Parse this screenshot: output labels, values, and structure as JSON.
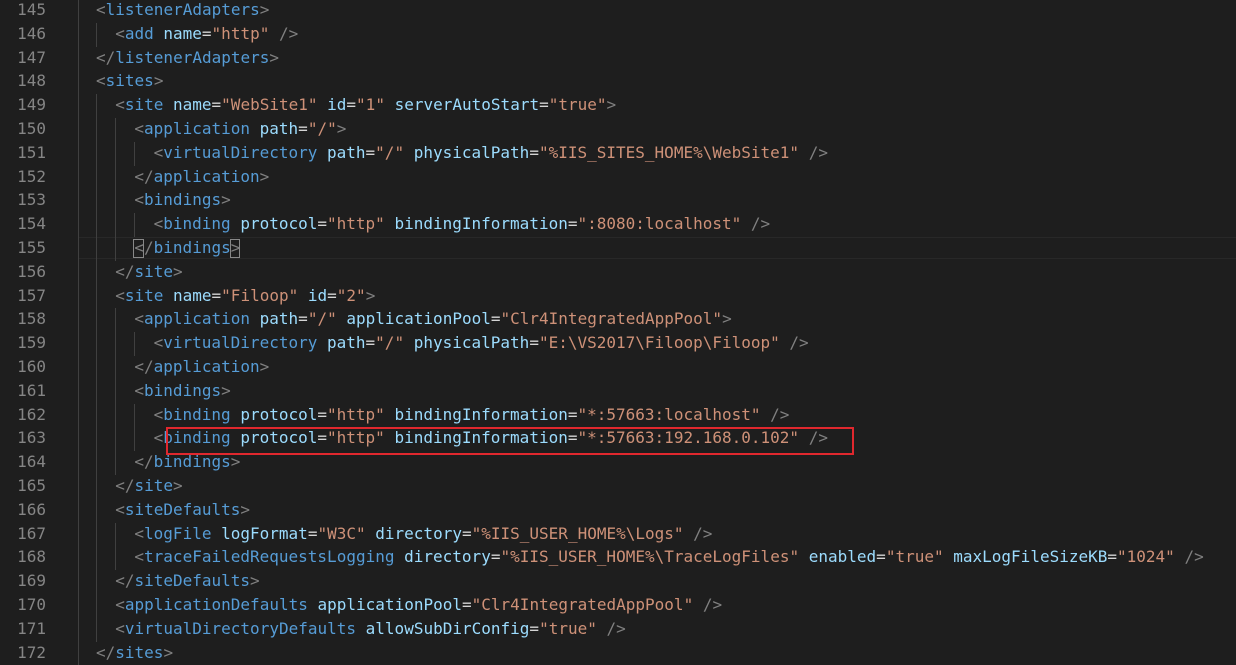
{
  "editor": {
    "lines": [
      {
        "num": "145",
        "indent": 1,
        "tokens": [
          [
            "p",
            "<"
          ],
          [
            "t",
            "listenerAdapters"
          ],
          [
            "p",
            ">"
          ]
        ]
      },
      {
        "num": "146",
        "indent": 2,
        "tokens": [
          [
            "p",
            "<"
          ],
          [
            "t",
            "add"
          ],
          [
            "x",
            " "
          ],
          [
            "a",
            "name"
          ],
          [
            "e",
            "="
          ],
          [
            "s",
            "\"http\""
          ],
          [
            "x",
            " "
          ],
          [
            "p",
            "/>"
          ]
        ]
      },
      {
        "num": "147",
        "indent": 1,
        "tokens": [
          [
            "p",
            "</"
          ],
          [
            "t",
            "listenerAdapters"
          ],
          [
            "p",
            ">"
          ]
        ]
      },
      {
        "num": "148",
        "indent": 1,
        "tokens": [
          [
            "p",
            "<"
          ],
          [
            "t",
            "sites"
          ],
          [
            "p",
            ">"
          ]
        ]
      },
      {
        "num": "149",
        "indent": 2,
        "tokens": [
          [
            "p",
            "<"
          ],
          [
            "t",
            "site"
          ],
          [
            "x",
            " "
          ],
          [
            "a",
            "name"
          ],
          [
            "e",
            "="
          ],
          [
            "s",
            "\"WebSite1\""
          ],
          [
            "x",
            " "
          ],
          [
            "a",
            "id"
          ],
          [
            "e",
            "="
          ],
          [
            "s",
            "\"1\""
          ],
          [
            "x",
            " "
          ],
          [
            "a",
            "serverAutoStart"
          ],
          [
            "e",
            "="
          ],
          [
            "s",
            "\"true\""
          ],
          [
            "p",
            ">"
          ]
        ]
      },
      {
        "num": "150",
        "indent": 3,
        "tokens": [
          [
            "p",
            "<"
          ],
          [
            "t",
            "application"
          ],
          [
            "x",
            " "
          ],
          [
            "a",
            "path"
          ],
          [
            "e",
            "="
          ],
          [
            "s",
            "\"/\""
          ],
          [
            "p",
            ">"
          ]
        ]
      },
      {
        "num": "151",
        "indent": 4,
        "tokens": [
          [
            "p",
            "<"
          ],
          [
            "t",
            "virtualDirectory"
          ],
          [
            "x",
            " "
          ],
          [
            "a",
            "path"
          ],
          [
            "e",
            "="
          ],
          [
            "s",
            "\"/\""
          ],
          [
            "x",
            " "
          ],
          [
            "a",
            "physicalPath"
          ],
          [
            "e",
            "="
          ],
          [
            "s",
            "\"%IIS_SITES_HOME%\\WebSite1\""
          ],
          [
            "x",
            " "
          ],
          [
            "p",
            "/>"
          ]
        ]
      },
      {
        "num": "152",
        "indent": 3,
        "tokens": [
          [
            "p",
            "</"
          ],
          [
            "t",
            "application"
          ],
          [
            "p",
            ">"
          ]
        ]
      },
      {
        "num": "153",
        "indent": 3,
        "tokens": [
          [
            "p",
            "<"
          ],
          [
            "t",
            "bindings"
          ],
          [
            "p",
            ">"
          ]
        ]
      },
      {
        "num": "154",
        "indent": 4,
        "tokens": [
          [
            "p",
            "<"
          ],
          [
            "t",
            "binding"
          ],
          [
            "x",
            " "
          ],
          [
            "a",
            "protocol"
          ],
          [
            "e",
            "="
          ],
          [
            "s",
            "\"http\""
          ],
          [
            "x",
            " "
          ],
          [
            "a",
            "bindingInformation"
          ],
          [
            "e",
            "="
          ],
          [
            "s",
            "\":8080:localhost\""
          ],
          [
            "x",
            " "
          ],
          [
            "p",
            "/>"
          ]
        ]
      },
      {
        "num": "155",
        "indent": 3,
        "tokens": [
          [
            "p",
            "</"
          ],
          [
            "t",
            "bindings"
          ],
          [
            "p",
            ">"
          ]
        ],
        "current": true
      },
      {
        "num": "156",
        "indent": 2,
        "tokens": [
          [
            "p",
            "</"
          ],
          [
            "t",
            "site"
          ],
          [
            "p",
            ">"
          ]
        ]
      },
      {
        "num": "157",
        "indent": 2,
        "tokens": [
          [
            "p",
            "<"
          ],
          [
            "t",
            "site"
          ],
          [
            "x",
            " "
          ],
          [
            "a",
            "name"
          ],
          [
            "e",
            "="
          ],
          [
            "s",
            "\"Filoop\""
          ],
          [
            "x",
            " "
          ],
          [
            "a",
            "id"
          ],
          [
            "e",
            "="
          ],
          [
            "s",
            "\"2\""
          ],
          [
            "p",
            ">"
          ]
        ]
      },
      {
        "num": "158",
        "indent": 3,
        "tokens": [
          [
            "p",
            "<"
          ],
          [
            "t",
            "application"
          ],
          [
            "x",
            " "
          ],
          [
            "a",
            "path"
          ],
          [
            "e",
            "="
          ],
          [
            "s",
            "\"/\""
          ],
          [
            "x",
            " "
          ],
          [
            "a",
            "applicationPool"
          ],
          [
            "e",
            "="
          ],
          [
            "s",
            "\"Clr4IntegratedAppPool\""
          ],
          [
            "p",
            ">"
          ]
        ]
      },
      {
        "num": "159",
        "indent": 4,
        "tokens": [
          [
            "p",
            "<"
          ],
          [
            "t",
            "virtualDirectory"
          ],
          [
            "x",
            " "
          ],
          [
            "a",
            "path"
          ],
          [
            "e",
            "="
          ],
          [
            "s",
            "\"/\""
          ],
          [
            "x",
            " "
          ],
          [
            "a",
            "physicalPath"
          ],
          [
            "e",
            "="
          ],
          [
            "s",
            "\"E:\\VS2017\\Filoop\\Filoop\""
          ],
          [
            "x",
            " "
          ],
          [
            "p",
            "/>"
          ]
        ]
      },
      {
        "num": "160",
        "indent": 3,
        "tokens": [
          [
            "p",
            "</"
          ],
          [
            "t",
            "application"
          ],
          [
            "p",
            ">"
          ]
        ]
      },
      {
        "num": "161",
        "indent": 3,
        "tokens": [
          [
            "p",
            "<"
          ],
          [
            "t",
            "bindings"
          ],
          [
            "p",
            ">"
          ]
        ]
      },
      {
        "num": "162",
        "indent": 4,
        "tokens": [
          [
            "p",
            "<"
          ],
          [
            "t",
            "binding"
          ],
          [
            "x",
            " "
          ],
          [
            "a",
            "protocol"
          ],
          [
            "e",
            "="
          ],
          [
            "s",
            "\"http\""
          ],
          [
            "x",
            " "
          ],
          [
            "a",
            "bindingInformation"
          ],
          [
            "e",
            "="
          ],
          [
            "s",
            "\"*:57663:localhost\""
          ],
          [
            "x",
            " "
          ],
          [
            "p",
            "/>"
          ]
        ]
      },
      {
        "num": "163",
        "indent": 4,
        "tokens": [
          [
            "p",
            "<"
          ],
          [
            "t",
            "binding"
          ],
          [
            "x",
            " "
          ],
          [
            "a",
            "protocol"
          ],
          [
            "e",
            "="
          ],
          [
            "s",
            "\"http\""
          ],
          [
            "x",
            " "
          ],
          [
            "a",
            "bindingInformation"
          ],
          [
            "e",
            "="
          ],
          [
            "s",
            "\"*:57663:192.168.0.102\""
          ],
          [
            "x",
            " "
          ],
          [
            "p",
            "/>"
          ]
        ],
        "highlighted": true
      },
      {
        "num": "164",
        "indent": 3,
        "tokens": [
          [
            "p",
            "</"
          ],
          [
            "t",
            "bindings"
          ],
          [
            "p",
            ">"
          ]
        ]
      },
      {
        "num": "165",
        "indent": 2,
        "tokens": [
          [
            "p",
            "</"
          ],
          [
            "t",
            "site"
          ],
          [
            "p",
            ">"
          ]
        ]
      },
      {
        "num": "166",
        "indent": 2,
        "tokens": [
          [
            "p",
            "<"
          ],
          [
            "t",
            "siteDefaults"
          ],
          [
            "p",
            ">"
          ]
        ]
      },
      {
        "num": "167",
        "indent": 3,
        "tokens": [
          [
            "p",
            "<"
          ],
          [
            "t",
            "logFile"
          ],
          [
            "x",
            " "
          ],
          [
            "a",
            "logFormat"
          ],
          [
            "e",
            "="
          ],
          [
            "s",
            "\"W3C\""
          ],
          [
            "x",
            " "
          ],
          [
            "a",
            "directory"
          ],
          [
            "e",
            "="
          ],
          [
            "s",
            "\"%IIS_USER_HOME%\\Logs\""
          ],
          [
            "x",
            " "
          ],
          [
            "p",
            "/>"
          ]
        ]
      },
      {
        "num": "168",
        "indent": 3,
        "tokens": [
          [
            "p",
            "<"
          ],
          [
            "t",
            "traceFailedRequestsLogging"
          ],
          [
            "x",
            " "
          ],
          [
            "a",
            "directory"
          ],
          [
            "e",
            "="
          ],
          [
            "s",
            "\"%IIS_USER_HOME%\\TraceLogFiles\""
          ],
          [
            "x",
            " "
          ],
          [
            "a",
            "enabled"
          ],
          [
            "e",
            "="
          ],
          [
            "s",
            "\"true\""
          ],
          [
            "x",
            " "
          ],
          [
            "a",
            "maxLogFileSizeKB"
          ],
          [
            "e",
            "="
          ],
          [
            "s",
            "\"1024\""
          ],
          [
            "x",
            " "
          ],
          [
            "p",
            "/>"
          ]
        ]
      },
      {
        "num": "169",
        "indent": 2,
        "tokens": [
          [
            "p",
            "</"
          ],
          [
            "t",
            "siteDefaults"
          ],
          [
            "p",
            ">"
          ]
        ]
      },
      {
        "num": "170",
        "indent": 2,
        "tokens": [
          [
            "p",
            "<"
          ],
          [
            "t",
            "applicationDefaults"
          ],
          [
            "x",
            " "
          ],
          [
            "a",
            "applicationPool"
          ],
          [
            "e",
            "="
          ],
          [
            "s",
            "\"Clr4IntegratedAppPool\""
          ],
          [
            "x",
            " "
          ],
          [
            "p",
            "/>"
          ]
        ]
      },
      {
        "num": "171",
        "indent": 2,
        "tokens": [
          [
            "p",
            "<"
          ],
          [
            "t",
            "virtualDirectoryDefaults"
          ],
          [
            "x",
            " "
          ],
          [
            "a",
            "allowSubDirConfig"
          ],
          [
            "e",
            "="
          ],
          [
            "s",
            "\"true\""
          ],
          [
            "x",
            " "
          ],
          [
            "p",
            "/>"
          ]
        ]
      },
      {
        "num": "172",
        "indent": 1,
        "tokens": [
          [
            "p",
            "</"
          ],
          [
            "t",
            "sites"
          ],
          [
            "p",
            ">"
          ]
        ]
      }
    ]
  },
  "colors": {
    "background": "#1e1e1e",
    "line_number": "#858585",
    "punctuation": "#808080",
    "tag": "#569cd6",
    "attribute": "#9cdcfe",
    "string": "#ce9178",
    "highlight_box": "#e0282e"
  }
}
